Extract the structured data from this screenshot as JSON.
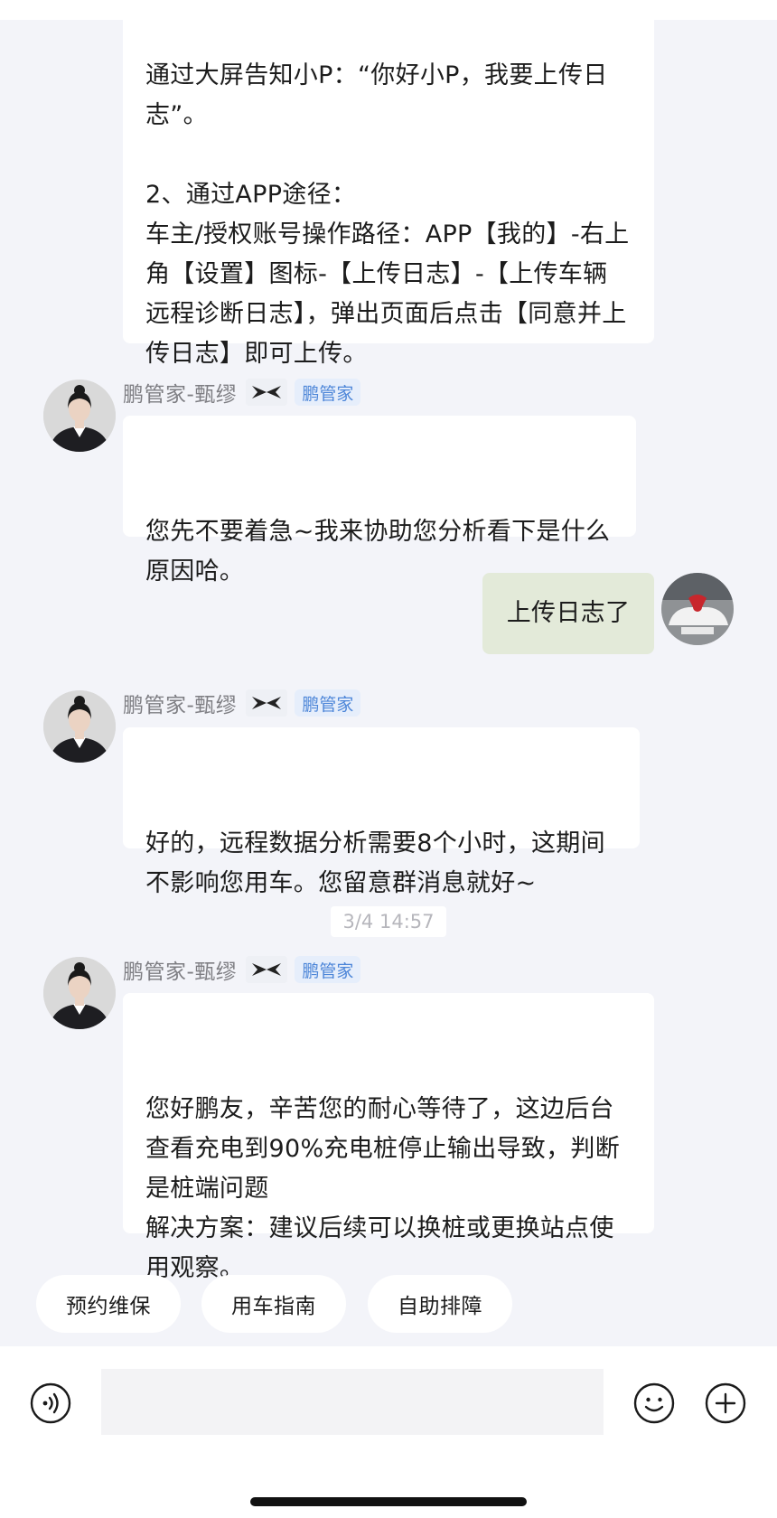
{
  "messages": [
    {
      "text": "志”。\n\n2、通过APP途径：\n车主/授权账号操作路径：APP【我的】-右上角【设置】图标-【上传日志】-【上传车辆远程诊断日志】，弹出页面后点击【同意并上传日志】即可上传。",
      "partial_line_top": "通过大屏告知小P：“你好小P，我要上传日"
    },
    {
      "sender": "鹏管家-甄缪",
      "role_tag": "鹏管家",
      "text": "您先不要着急~我来协助您分析看下是什么原因哈。"
    },
    {
      "sender": "me",
      "text": "上传日志了"
    },
    {
      "sender": "鹏管家-甄缪",
      "role_tag": "鹏管家",
      "text": "好的，远程数据分析需要8个小时，这期间不影响您用车。您留意群消息就好~"
    },
    {
      "sender": "鹏管家-甄缪",
      "role_tag": "鹏管家",
      "text": "您好鹏友，辛苦您的耐心等待了，这边后台查看充电到90%充电桩停止输出导致，判断是桩端问题\n解决方案：建议后续可以换桩或更换站点使用观察。"
    }
  ],
  "timestamp": "3/4 14:57",
  "quick_actions": [
    "预约维保",
    "用车指南",
    "自助排障"
  ],
  "input": {
    "value": "",
    "placeholder": ""
  },
  "icons": {
    "voice": "voice-input-icon",
    "emoji": "emoji-icon",
    "more": "plus-icon",
    "brand": "xpeng-logo-icon"
  },
  "colors": {
    "page_bg": "#f3f4f9",
    "bubble_incoming": "#ffffff",
    "bubble_outgoing": "#e3ead9",
    "role_tag_text": "#4d86d8",
    "role_tag_bg": "#e6eefb",
    "sender_name": "#7e7e83"
  }
}
